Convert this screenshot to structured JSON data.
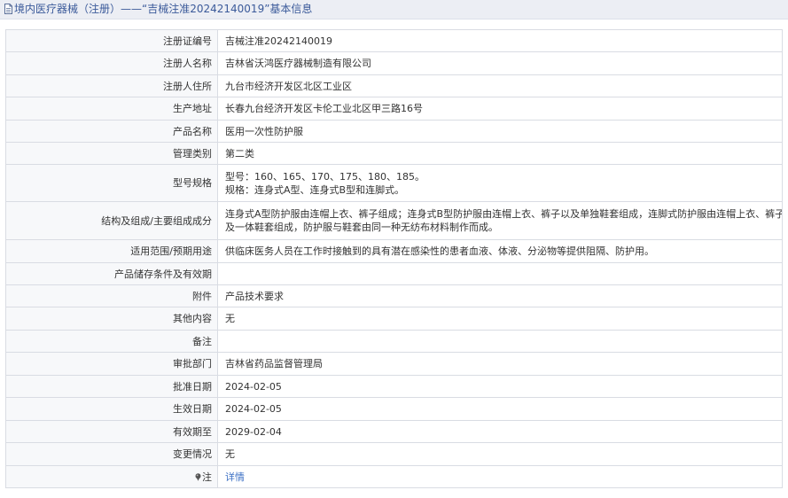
{
  "header": {
    "title": "境内医疗器械（注册）——“吉械注准20242140019”基本信息",
    "icon": "document-icon"
  },
  "rows": [
    {
      "label": "注册证编号",
      "value": "吉械注准20242140019"
    },
    {
      "label": "注册人名称",
      "value": "吉林省沃鸿医疗器械制造有限公司"
    },
    {
      "label": "注册人住所",
      "value": "九台市经济开发区北区工业区"
    },
    {
      "label": "生产地址",
      "value": "长春九台经济开发区卡伦工业北区甲三路16号"
    },
    {
      "label": "产品名称",
      "value": "医用一次性防护服"
    },
    {
      "label": "管理类别",
      "value": "第二类"
    },
    {
      "label": "型号规格",
      "lines": [
        "型号：160、165、170、175、180、185。",
        "规格：连身式A型、连身式B型和连脚式。"
      ]
    },
    {
      "label": "结构及组成/主要组成成分",
      "lines": [
        "连身式A型防护服由连帽上衣、裤子组成；连身式B型防护服由连帽上衣、裤子以及单独鞋套组成，连脚式防护服由连帽上衣、裤子以",
        "及一体鞋套组成，防护服与鞋套由同一种无纺布材料制作而成。"
      ]
    },
    {
      "label": "适用范围/预期用途",
      "value": "供临床医务人员在工作时接触到的具有潜在感染性的患者血液、体液、分泌物等提供阻隔、防护用。"
    },
    {
      "label": "产品储存条件及有效期",
      "value": ""
    },
    {
      "label": "附件",
      "value": "产品技术要求"
    },
    {
      "label": "其他内容",
      "value": "无"
    },
    {
      "label": "备注",
      "value": ""
    },
    {
      "label": "审批部门",
      "value": "吉林省药品监督管理局"
    },
    {
      "label": "批准日期",
      "value": "2024-02-05"
    },
    {
      "label": "生效日期",
      "value": "2024-02-05"
    },
    {
      "label": "有效期至",
      "value": "2029-02-04"
    },
    {
      "label": "变更情况",
      "value": "无"
    }
  ],
  "note_row": {
    "label": "注",
    "icon": "pin-icon",
    "link_text": "详情"
  },
  "colors": {
    "title_text": "#3b5a9a",
    "link": "#3b6fc4",
    "label_bg": "#f7f8fa",
    "border": "#d9dce3"
  }
}
